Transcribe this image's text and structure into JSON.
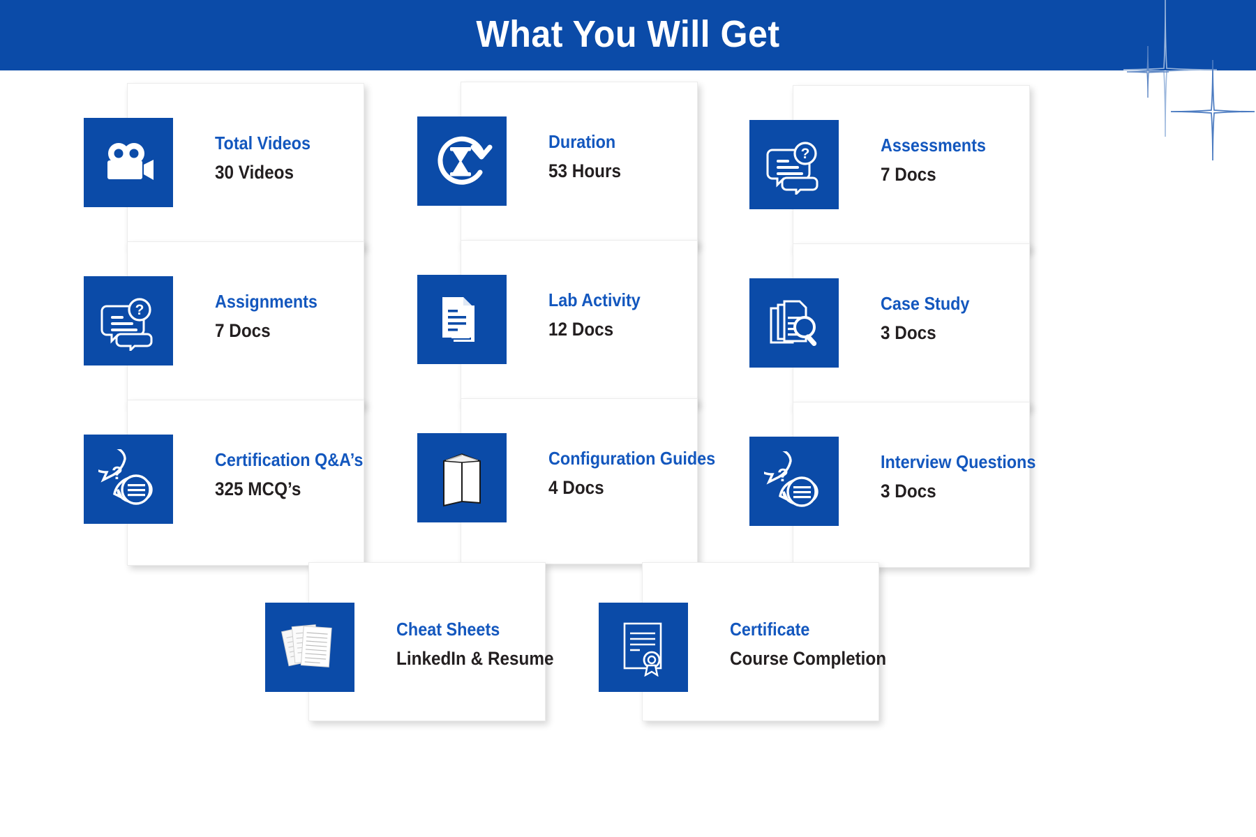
{
  "header": {
    "title": "What You Will Get",
    "background_color": "#0B4BA8",
    "title_color": "#ffffff"
  },
  "theme": {
    "brand_blue": "#0B4BA8",
    "title_blue": "#1357BE",
    "value_dark": "#231F20",
    "card_background": "#ffffff",
    "page_background": "#ffffff"
  },
  "decoration": {
    "sparkle_name": "four-point-star-sparkle",
    "count": 3
  },
  "cards": [
    {
      "id": "total-videos",
      "title": "Total Videos",
      "value": "30 Videos",
      "icon": "video-camera-icon"
    },
    {
      "id": "duration",
      "title": "Duration",
      "value": "53 Hours",
      "icon": "hourglass-refresh-icon"
    },
    {
      "id": "assessments",
      "title": "Assessments",
      "value": "7 Docs",
      "icon": "chat-question-icon"
    },
    {
      "id": "assignments",
      "title": "Assignments",
      "value": "7 Docs",
      "icon": "chat-question-icon"
    },
    {
      "id": "lab-activity",
      "title": "Lab Activity",
      "value": "12 Docs",
      "icon": "stacked-documents-icon"
    },
    {
      "id": "case-study",
      "title": "Case Study",
      "value": "3 Docs",
      "icon": "documents-magnifier-icon"
    },
    {
      "id": "certification-qa",
      "title": "Certification Q&A’s",
      "value": "325 MCQ’s",
      "icon": "speech-bubbles-question-icon"
    },
    {
      "id": "configuration-guides",
      "title": "Configuration Guides",
      "value": "4 Docs",
      "icon": "standing-book-icon"
    },
    {
      "id": "interview-questions",
      "title": "Interview Questions",
      "value": "3 Docs",
      "icon": "speech-bubbles-question-icon"
    },
    {
      "id": "cheat-sheets",
      "title": "Cheat Sheets",
      "value": "LinkedIn & Resume",
      "icon": "paper-sheets-icon"
    },
    {
      "id": "certificate",
      "title": "Certificate",
      "value": "Course Completion",
      "icon": "certificate-seal-icon"
    }
  ]
}
